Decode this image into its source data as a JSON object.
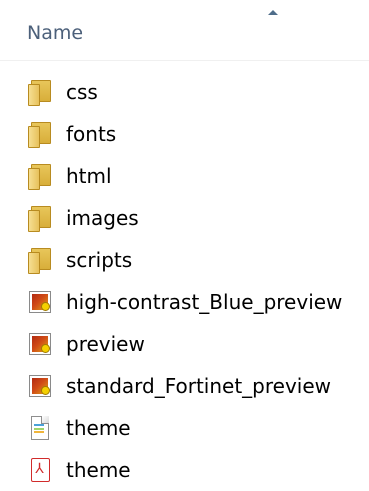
{
  "header": {
    "column_name": "Name",
    "sort_icon": "sort-ascending-icon"
  },
  "items": [
    {
      "label": "css",
      "icon": "folder-icon"
    },
    {
      "label": "fonts",
      "icon": "folder-icon"
    },
    {
      "label": "html",
      "icon": "folder-icon"
    },
    {
      "label": "images",
      "icon": "folder-icon"
    },
    {
      "label": "scripts",
      "icon": "folder-icon"
    },
    {
      "label": "high-contrast_Blue_preview",
      "icon": "image-file-icon"
    },
    {
      "label": "preview",
      "icon": "image-file-icon"
    },
    {
      "label": "standard_Fortinet_preview",
      "icon": "image-file-icon"
    },
    {
      "label": "theme",
      "icon": "text-file-icon"
    },
    {
      "label": "theme",
      "icon": "pdf-file-icon"
    }
  ]
}
